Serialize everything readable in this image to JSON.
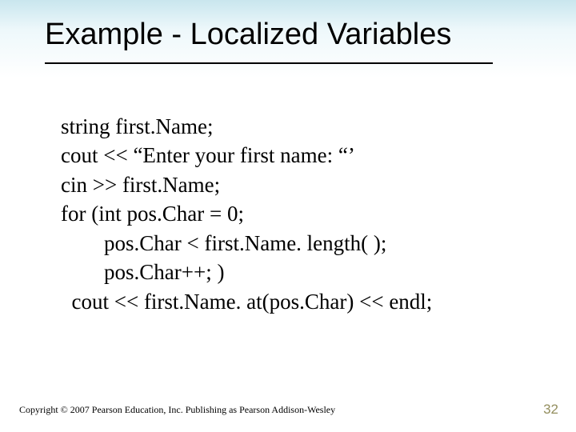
{
  "slide": {
    "title": "Example - Localized Variables",
    "code_lines": [
      "string first.Name;",
      "cout << “Enter your first name: “’",
      "cin >> first.Name;",
      "for (int pos.Char = 0;",
      "        pos.Char < first.Name. length( );",
      "        pos.Char++; )",
      "  cout << first.Name. at(pos.Char) << endl;"
    ],
    "footer": "Copyright © 2007 Pearson Education, Inc. Publishing as Pearson Addison-Wesley",
    "page_number": "32"
  }
}
